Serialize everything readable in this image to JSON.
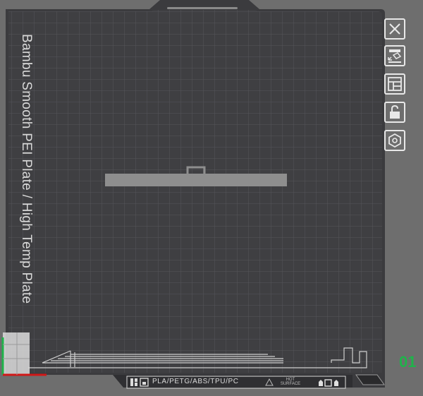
{
  "plate": {
    "label": "Bambu Smooth PEI Plate / High Temp Plate",
    "number": "01",
    "materials": "PLA/PETG/ABS/TPU/PC",
    "hot_surface": "HOT SURFACE"
  },
  "toolbar": {
    "buttons": [
      {
        "name": "close-plate-button",
        "icon": "close-icon"
      },
      {
        "name": "auto-arrange-button",
        "icon": "arrange-icon"
      },
      {
        "name": "orient-button",
        "icon": "layout-icon"
      },
      {
        "name": "lock-button",
        "icon": "unlock-icon"
      },
      {
        "name": "plate-settings-button",
        "icon": "settings-hex-icon"
      }
    ]
  },
  "colors": {
    "background": "#6e6e6e",
    "plate": "#3f3f42",
    "grid": "#5a5a5e",
    "model": "#8e8e8e",
    "accent_green": "#1fb34a",
    "axis_red": "#d01818"
  }
}
